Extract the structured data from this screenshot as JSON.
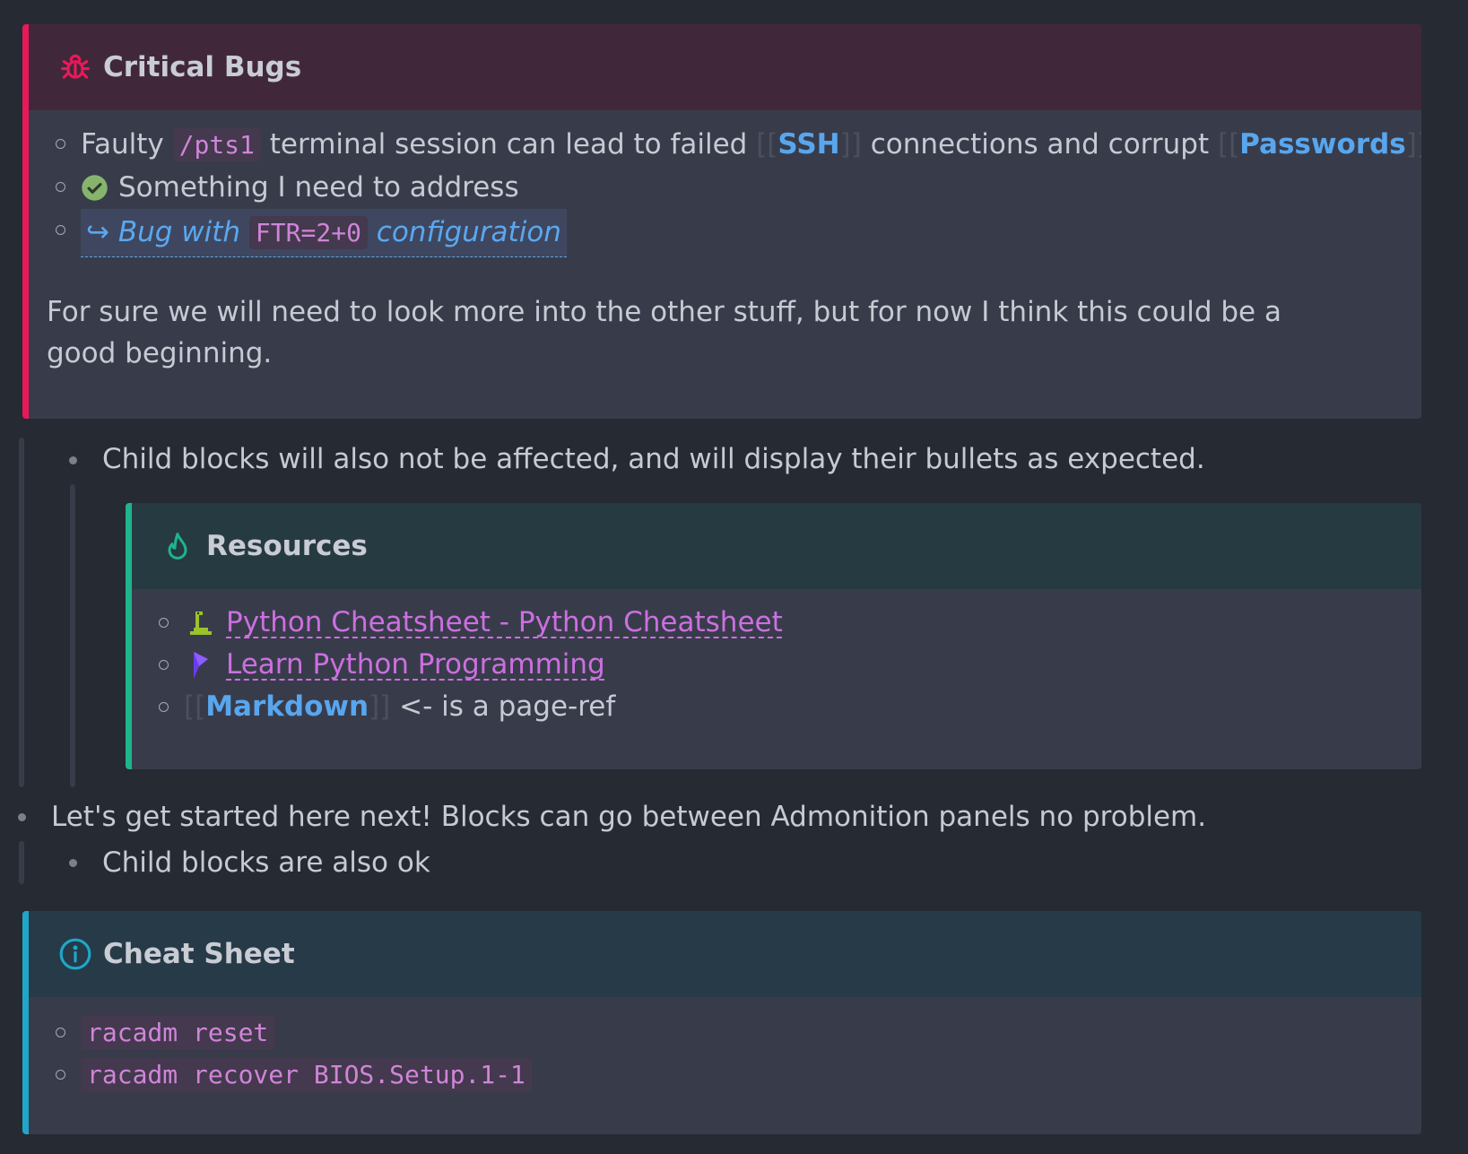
{
  "critical": {
    "title": "Critical Bugs",
    "icon": "bug-icon",
    "accent": "#e8195a",
    "header_bg": "#40283a",
    "item1": {
      "a": "Faulty",
      "code": "/pts1",
      "b": "terminal session can lead to failed",
      "ref1": "SSH",
      "c": "connections and corrupt",
      "ref2": "Passwords"
    },
    "item2": {
      "text": "Something I need to address",
      "icon": "check-circle-icon"
    },
    "item3": {
      "arrow": "↪",
      "a": "Bug with",
      "code": "FTR=2+0",
      "b": "configuration"
    },
    "paragraph": "For sure we will need to look more into the other stuff, but for now I think this could be a good beginning."
  },
  "child1": "Child blocks will also not be affected, and will display their bullets as expected.",
  "resources": {
    "title": "Resources",
    "icon": "flame-icon",
    "accent": "#1fb48c",
    "header_bg": "#263a42",
    "links": [
      {
        "text": "Python Cheatsheet - Python Cheatsheet",
        "icon": "python-snake-icon"
      },
      {
        "text": "Learn Python Programming",
        "icon": "programiz-logo-icon"
      }
    ],
    "pageref": {
      "ref": "Markdown",
      "suffix": "<- is a page-ref"
    }
  },
  "block2": "Let's get started here next! Blocks can go between Admonition panels no problem.",
  "child2": "Child blocks are also ok",
  "cheatsheet": {
    "title": "Cheat Sheet",
    "icon": "info-icon",
    "accent": "#20a6c8",
    "header_bg": "#263a48",
    "items": [
      "racadm reset",
      "racadm recover BIOS.Setup.1-1"
    ]
  },
  "brackets": {
    "open": "[[",
    "close": "]]"
  }
}
